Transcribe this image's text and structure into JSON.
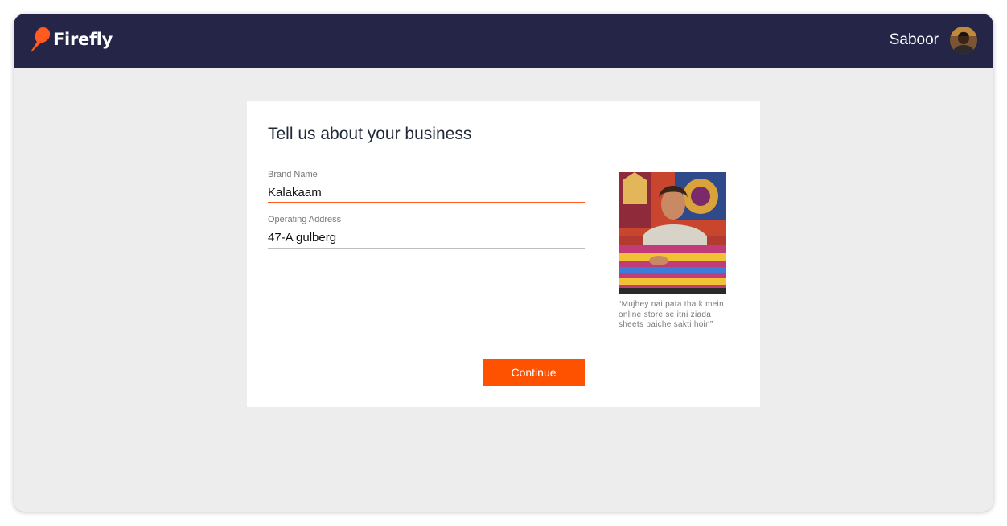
{
  "header": {
    "brand": "Firefly",
    "user_name": "Saboor",
    "brand_color": "#ff5a1f",
    "bar_color": "#252647"
  },
  "form": {
    "title": "Tell us about your business",
    "brand_name": {
      "label": "Brand Name",
      "value": "Kalakaam"
    },
    "operating_address": {
      "label": "Operating Address",
      "value": "47-A gulberg"
    },
    "continue_label": "Continue"
  },
  "testimonial": {
    "quote": "“Mujhey nai pata tha k mein online store se itni ziada sheets baiche sakti hoin”"
  },
  "colors": {
    "accent": "#ff5200",
    "background": "#ededed"
  }
}
